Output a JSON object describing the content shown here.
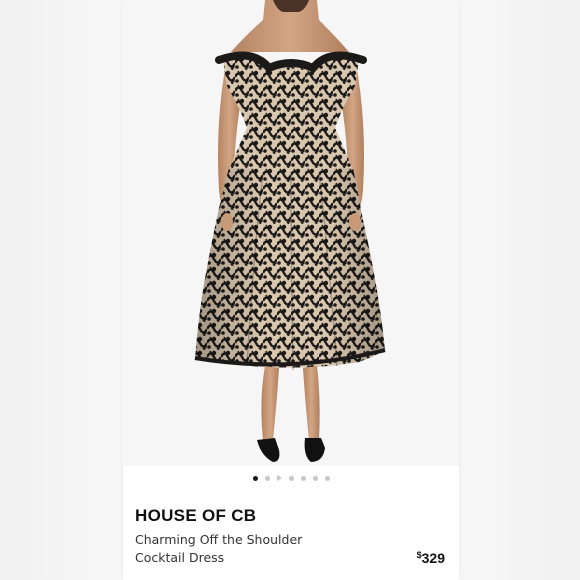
{
  "product": {
    "brand": "HOUSE OF CB",
    "name_line1": "Charming Off the Shoulder",
    "name_line2": "Cocktail Dress",
    "currency": "$",
    "price": "329"
  },
  "carousel": {
    "count": 7,
    "active_index": 0,
    "video_index": 2
  },
  "colors": {
    "dress_base": "#1c1a18",
    "lace_underlay": "#d9c6ae",
    "skin": "#c89a78"
  }
}
